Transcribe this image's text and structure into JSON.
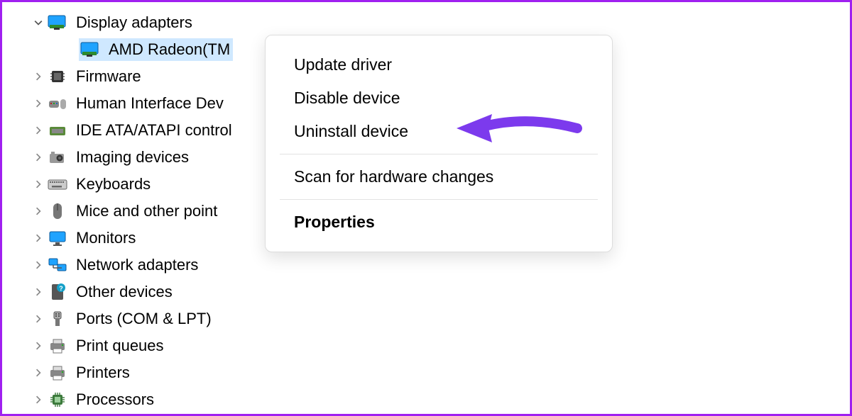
{
  "tree": {
    "display_adapters": {
      "label": "Display adapters"
    },
    "amd_radeon": {
      "label": "AMD Radeon(TM"
    },
    "firmware": {
      "label": "Firmware"
    },
    "hid": {
      "label": "Human Interface Dev"
    },
    "ide": {
      "label": "IDE ATA/ATAPI control"
    },
    "imaging": {
      "label": "Imaging devices"
    },
    "keyboards": {
      "label": "Keyboards"
    },
    "mice": {
      "label": "Mice and other point"
    },
    "monitors": {
      "label": "Monitors"
    },
    "network": {
      "label": "Network adapters"
    },
    "other": {
      "label": "Other devices"
    },
    "ports": {
      "label": "Ports (COM & LPT)"
    },
    "print_queues": {
      "label": "Print queues"
    },
    "printers": {
      "label": "Printers"
    },
    "processors": {
      "label": "Processors"
    }
  },
  "context_menu": {
    "update": "Update driver",
    "disable": "Disable device",
    "uninstall": "Uninstall device",
    "scan": "Scan for hardware changes",
    "properties": "Properties"
  },
  "colors": {
    "highlight_arrow": "#7c3aed",
    "selection_bg": "#cfe8ff",
    "border": "#a020f0"
  }
}
